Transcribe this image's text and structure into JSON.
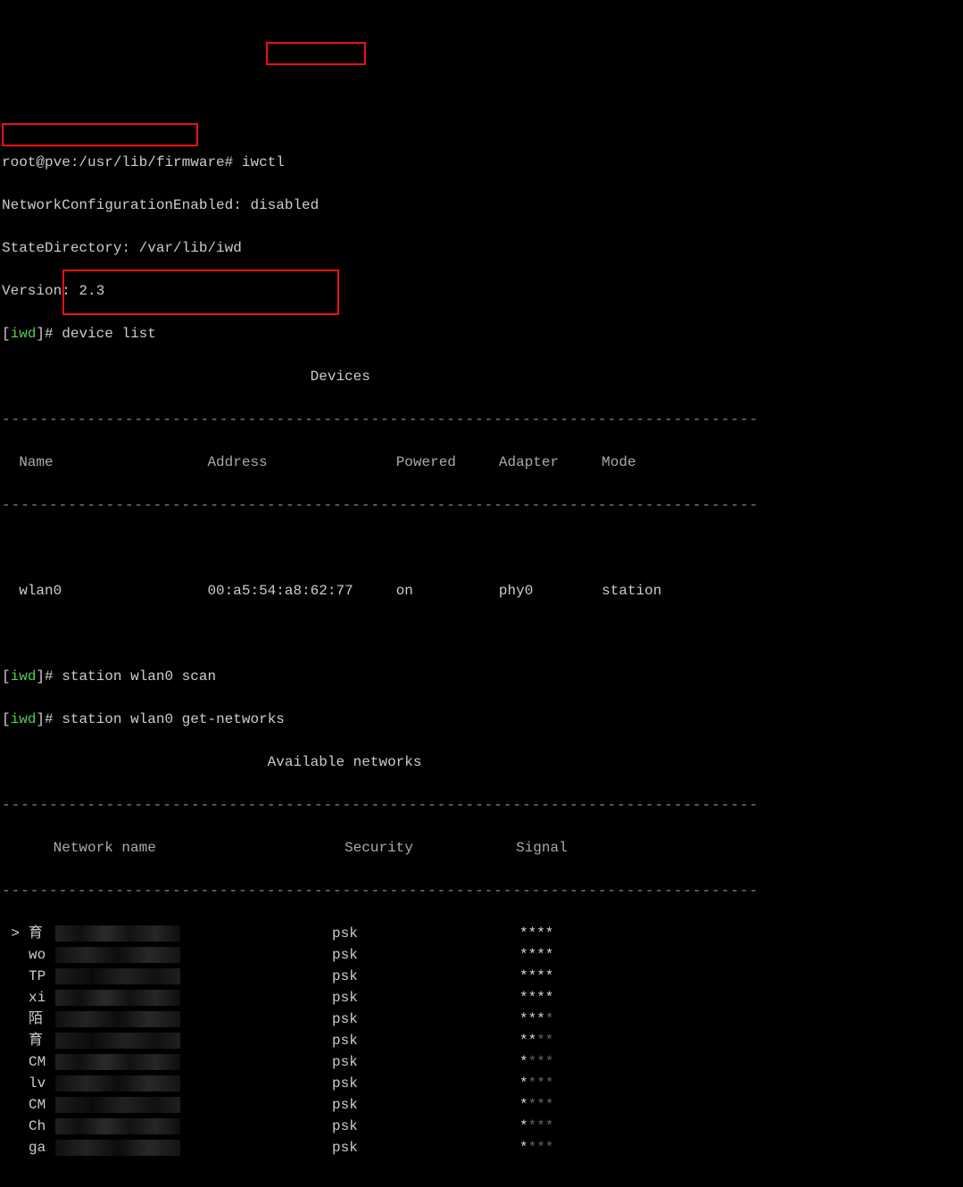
{
  "prompt1": {
    "user_host_path": "root@pve:/usr/lib/firmware#",
    "command": "iwctl"
  },
  "output": {
    "net_config": "NetworkConfigurationEnabled: disabled",
    "state_dir": "StateDirectory: /var/lib/iwd",
    "version": "Version: 2.3"
  },
  "iwd_prompt": "iwd",
  "hash": "#",
  "commands": {
    "device_list": "device list",
    "scan": "station wlan0 scan",
    "get_networks": "station wlan0 get-networks"
  },
  "dash_line": "--------------------------------------------------------------------------------",
  "devices": {
    "title": "Devices",
    "headers": [
      "Name",
      "Address",
      "Powered",
      "Adapter",
      "Mode"
    ],
    "row": {
      "name": "wlan0",
      "address": "00:a5:54:a8:62:77",
      "powered": "on",
      "adapter": "phy0",
      "mode": "station"
    }
  },
  "networks": {
    "title": "Available networks",
    "headers": [
      "Network name",
      "Security",
      "Signal"
    ],
    "rows": [
      {
        "marker": ">",
        "prefix": "育",
        "security": "psk",
        "signal_strong": "****",
        "signal_weak": ""
      },
      {
        "marker": " ",
        "prefix": "wo",
        "security": "psk",
        "signal_strong": "****",
        "signal_weak": ""
      },
      {
        "marker": " ",
        "prefix": "TP",
        "security": "psk",
        "signal_strong": "****",
        "signal_weak": ""
      },
      {
        "marker": " ",
        "prefix": "xi",
        "security": "psk",
        "signal_strong": "****",
        "signal_weak": ""
      },
      {
        "marker": " ",
        "prefix": "陌",
        "security": "psk",
        "signal_strong": "***",
        "signal_weak": "*"
      },
      {
        "marker": " ",
        "prefix": "育",
        "security": "psk",
        "signal_strong": "**",
        "signal_weak": "**"
      },
      {
        "marker": " ",
        "prefix": "CM",
        "security": "psk",
        "signal_strong": "*",
        "signal_weak": "***"
      },
      {
        "marker": " ",
        "prefix": "lv",
        "security": "psk",
        "signal_strong": "*",
        "signal_weak": "***"
      },
      {
        "marker": " ",
        "prefix": "CM",
        "security": "psk",
        "signal_strong": "*",
        "signal_weak": "***"
      },
      {
        "marker": " ",
        "prefix": "Ch",
        "security": "psk",
        "signal_strong": "*",
        "signal_weak": "***"
      },
      {
        "marker": " ",
        "prefix": "ga",
        "security": "psk",
        "signal_strong": "*",
        "signal_weak": "***"
      }
    ]
  }
}
